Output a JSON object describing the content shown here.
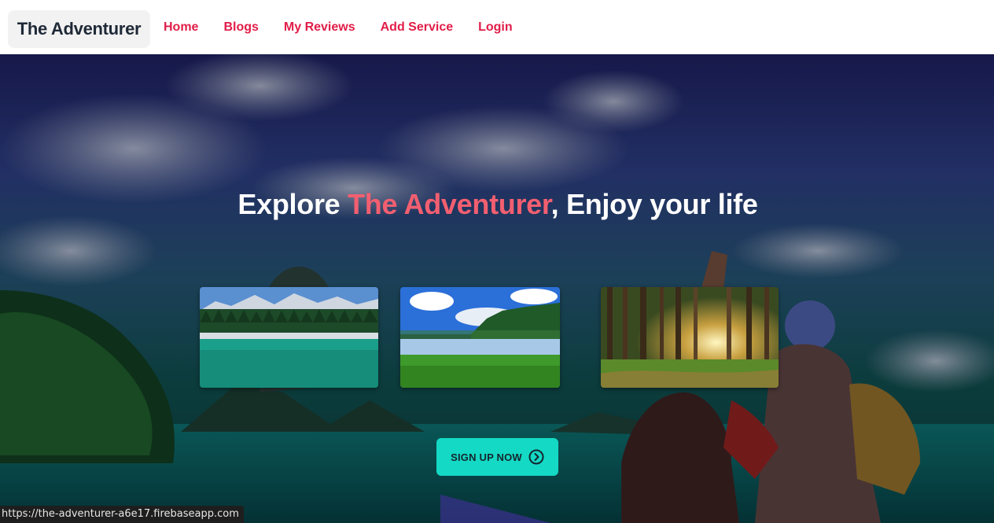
{
  "navbar": {
    "brand": "The Adventurer",
    "links": [
      "Home",
      "Blogs",
      "My Reviews",
      "Add Service",
      "Login"
    ]
  },
  "hero": {
    "headline_prefix": "Explore ",
    "headline_accent": "The Adventurer",
    "headline_suffix": ", Enjoy your life",
    "cta_label": "SIGN UP NOW",
    "cta_icon": "chevron-right-circle-icon",
    "thumbnails": [
      "mountain-lake-image",
      "meadow-lake-image",
      "sunlit-forest-image"
    ]
  },
  "status_bar": {
    "url": "https://the-adventurer-a6e17.firebaseapp.com"
  },
  "colors": {
    "accent": "#e11d48",
    "headline_accent": "#f25f70",
    "cta": "#14d9c4"
  }
}
